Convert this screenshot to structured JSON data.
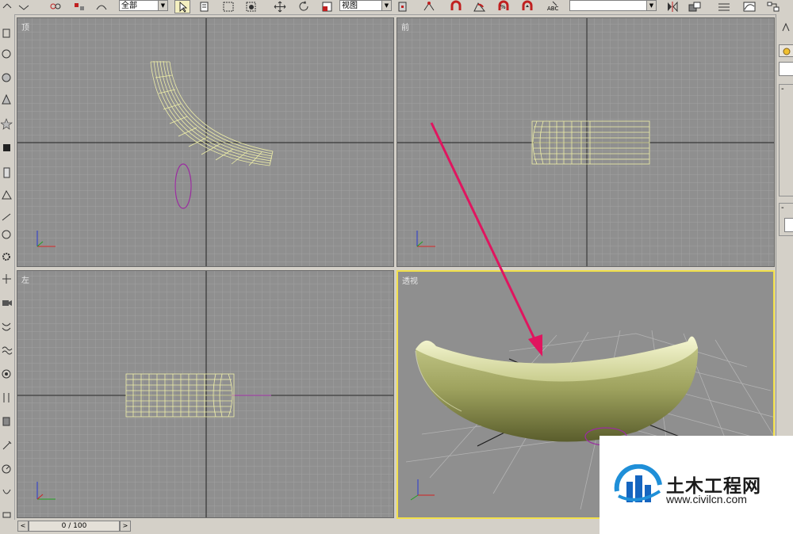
{
  "toolbar": {
    "selection_filter": "全部",
    "reference_coord": "视图",
    "named_selection": ""
  },
  "viewports": {
    "top": {
      "label": "顶"
    },
    "front": {
      "label": "前"
    },
    "left": {
      "label": "左"
    },
    "perspective": {
      "label": "透视"
    }
  },
  "timeline": {
    "frame": "0 / 100"
  },
  "watermark": {
    "name": "土木工程网",
    "url": "www.civilcn.com"
  },
  "colors": {
    "viewport_bg": "#8f8f8f",
    "grid": "#a8a8a8",
    "wireframe": "#efefa8",
    "active_border": "#f2e04a",
    "annotation_arrow": "#e0155f",
    "shape_purple": "#9b2ca0"
  }
}
